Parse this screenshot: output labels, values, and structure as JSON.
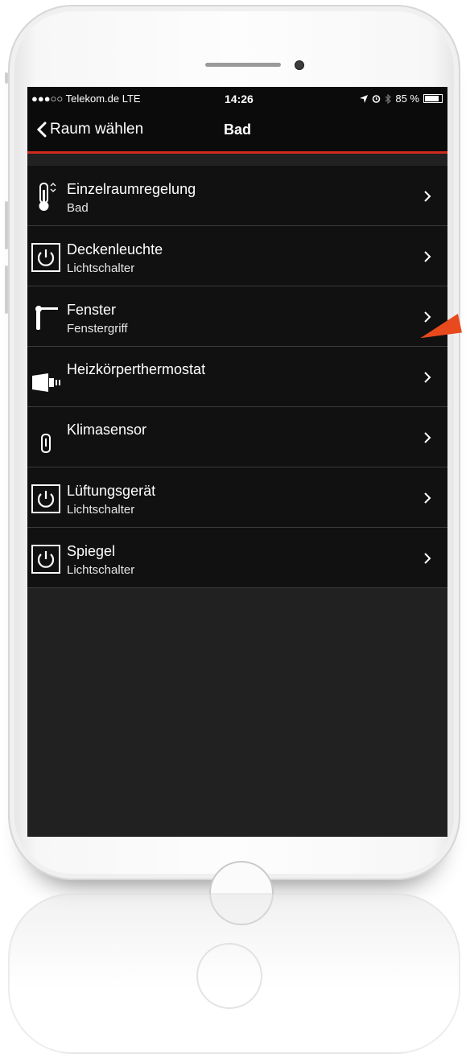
{
  "status_bar": {
    "carrier": "●●●○○ Telekom.de  LTE",
    "time": "14:26",
    "battery": "85 %",
    "icons": [
      "location-icon",
      "alarm-icon",
      "bluetooth-icon",
      "battery-icon"
    ]
  },
  "nav": {
    "back_label": "Raum wählen",
    "title": "Bad"
  },
  "accent_color": "#d12a1f",
  "devices": [
    {
      "title": "Einzelraumregelung",
      "subtitle": "Bad",
      "icon": "thermometer-icon"
    },
    {
      "title": "Deckenleuchte",
      "subtitle": "Lichtschalter",
      "icon": "power-switch-icon"
    },
    {
      "title": "Fenster",
      "subtitle": "Fenstergriff",
      "icon": "window-handle-icon"
    },
    {
      "title": "Heizkörperthermostat",
      "subtitle": "",
      "icon": "radiator-thermostat-icon"
    },
    {
      "title": "Klimasensor",
      "subtitle": "",
      "icon": "climate-sensor-icon"
    },
    {
      "title": "Lüftungsgerät",
      "subtitle": "Lichtschalter",
      "icon": "power-switch-icon"
    },
    {
      "title": "Spiegel",
      "subtitle": "Lichtschalter",
      "icon": "power-switch-icon"
    }
  ]
}
